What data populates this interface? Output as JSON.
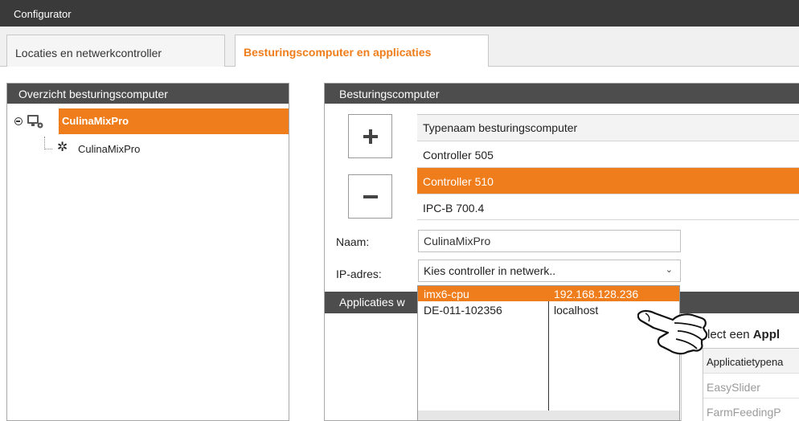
{
  "window": {
    "title": "Configurator"
  },
  "tabs": [
    {
      "label": "Locaties en netwerkcontroller",
      "active": false
    },
    {
      "label": "Besturingscomputer en applicaties",
      "active": true
    }
  ],
  "left_panel": {
    "header": "Overzicht besturingscomputer",
    "tree": {
      "root": {
        "label": "CulinaMixPro",
        "icon": "computer-settings-icon"
      },
      "child": {
        "label": "CulinaMixPro",
        "icon": "gear-icon"
      }
    }
  },
  "right_panel": {
    "header": "Besturingscomputer",
    "buttons": {
      "add": "plus-icon",
      "remove": "minus-icon"
    },
    "table": {
      "header": "Typenaam besturingscomputer",
      "rows": [
        "Controller 505",
        "Controller 510",
        "IPC-B 700.4"
      ],
      "selected": "Controller 510"
    },
    "naam_label": "Naam:",
    "naam_value": "CulinaMixPro",
    "ip_label": "IP-adres:",
    "ip_select_value": "Kies controller in netwerk..",
    "apps_header": "Applicaties w",
    "apps_select": {
      "title_prefix": "lect een ",
      "title_bold": "Appl",
      "column_header": "Applicatietypena",
      "rows": [
        "EasySlider",
        "FarmFeedingP"
      ]
    }
  },
  "dropdown": {
    "options": [
      {
        "name": "imx6-cpu",
        "address": "192.168.128.236",
        "highlighted": true
      },
      {
        "name": "DE-011-102356",
        "address": "localhost",
        "highlighted": false
      }
    ]
  },
  "colors": {
    "accent": "#f07d1b",
    "header": "#4d4d4d",
    "titlebar": "#3a3a3a"
  }
}
